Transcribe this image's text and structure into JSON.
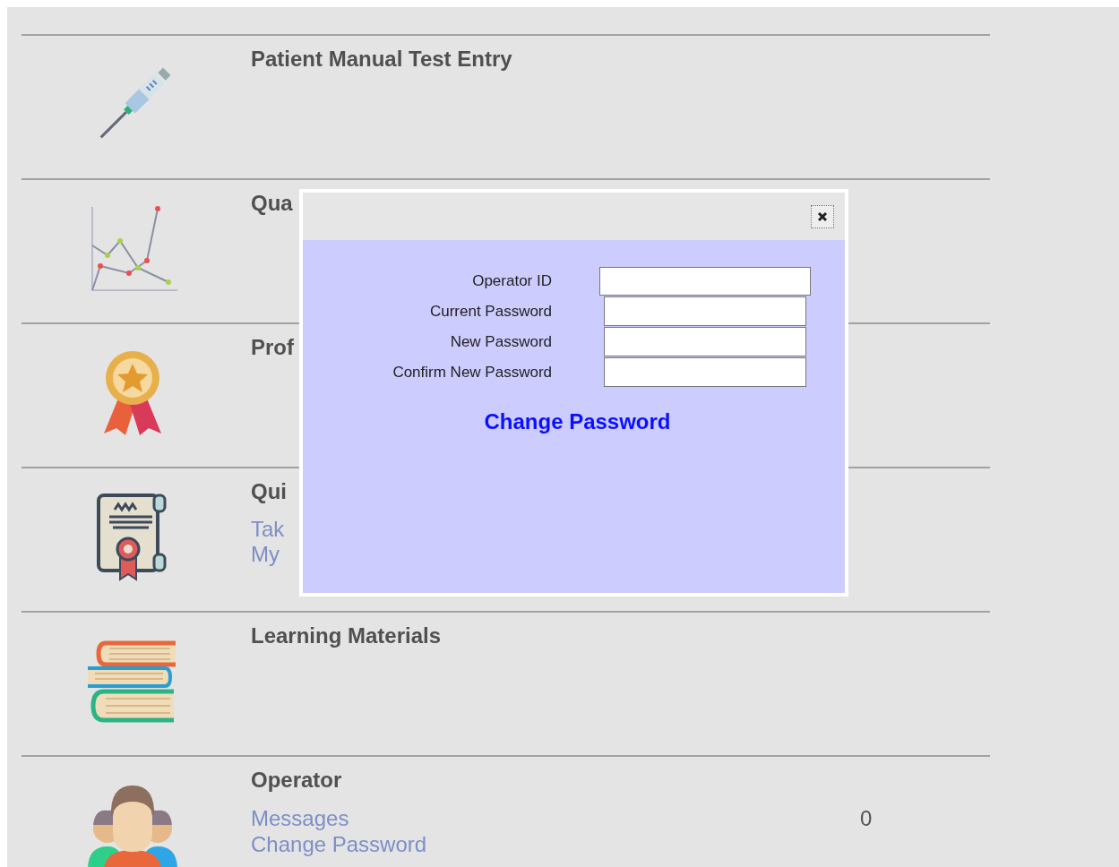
{
  "sections": [
    {
      "kind": "syringe",
      "title": "Patient Manual Test Entry"
    },
    {
      "kind": "chart",
      "title": "Qua"
    },
    {
      "kind": "medal",
      "title": "Prof"
    },
    {
      "kind": "certificate",
      "title": "Qui",
      "links": [
        {
          "label": "Tak"
        },
        {
          "label": "My"
        }
      ]
    },
    {
      "kind": "books",
      "title": "Learning Materials"
    },
    {
      "kind": "people",
      "title": "Operator",
      "links": [
        {
          "label": "Messages",
          "count": "0"
        },
        {
          "label": "Change Password"
        }
      ]
    }
  ],
  "dialog": {
    "fields": [
      {
        "label": "Operator ID"
      },
      {
        "label": "Current Password"
      },
      {
        "label": "New Password"
      },
      {
        "label": "Confirm New Password"
      }
    ],
    "submit": "Change Password"
  }
}
